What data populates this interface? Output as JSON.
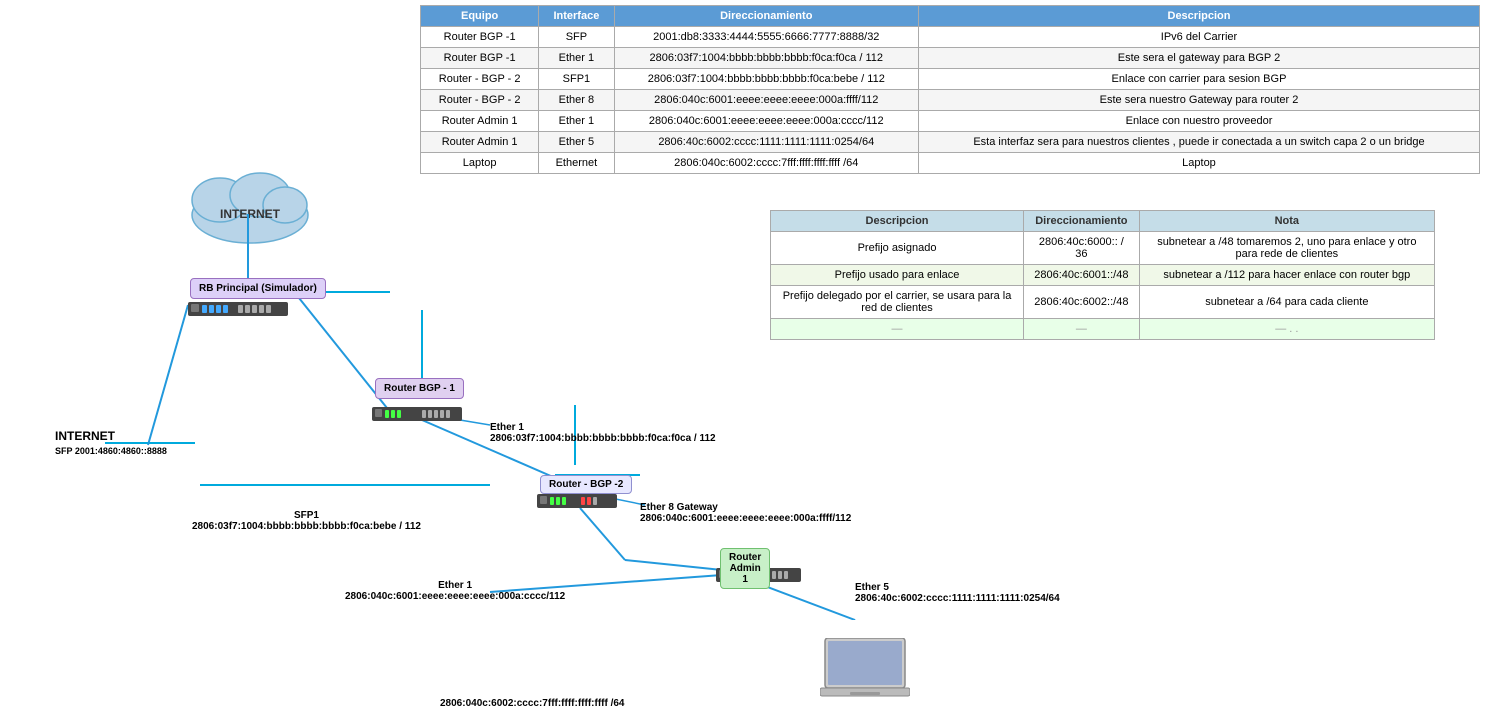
{
  "tables": {
    "main": {
      "headers": [
        "Equipo",
        "Interface",
        "Direccionamiento",
        "Descripcion"
      ],
      "rows": [
        {
          "equipo": "Router BGP -1",
          "interface": "SFP",
          "direccionamiento": "2001:db8:3333:4444:5555:6666:7777:8888/32",
          "descripcion": "IPv6 del Carrier"
        },
        {
          "equipo": "Router BGP -1",
          "interface": "Ether 1",
          "direccionamiento": "2806:03f7:1004:bbbb:bbbb:bbbb:f0ca:f0ca / 112",
          "descripcion": "Este sera el gateway para BGP 2"
        },
        {
          "equipo": "Router - BGP - 2",
          "interface": "SFP1",
          "direccionamiento": "2806:03f7:1004:bbbb:bbbb:bbbb:f0ca:bebe / 112",
          "descripcion": "Enlace con carrier para sesion BGP"
        },
        {
          "equipo": "Router - BGP - 2",
          "interface": "Ether 8",
          "direccionamiento": "2806:040c:6001:eeee:eeee:eeee:000a:ffff/112",
          "descripcion": "Este sera nuestro Gateway para router 2"
        },
        {
          "equipo": "Router Admin 1",
          "interface": "Ether 1",
          "direccionamiento": "2806:040c:6001:eeee:eeee:eeee:000a:cccc/112",
          "descripcion": "Enlace con nuestro proveedor"
        },
        {
          "equipo": "Router Admin 1",
          "interface": "Ether 5",
          "direccionamiento": "2806:40c:6002:cccc:1111:1111:1111:0254/64",
          "descripcion": "Esta interfaz sera para nuestros clientes , puede ir conectada a un switch capa 2 o un bridge"
        },
        {
          "equipo": "Laptop",
          "interface": "Ethernet",
          "direccionamiento": "2806:040c:6002:cccc:7fff:ffff:ffff:ffff /64",
          "descripcion": "Laptop"
        }
      ]
    },
    "second": {
      "headers": [
        "Descripcion",
        "Direccionamiento",
        "Nota"
      ],
      "rows": [
        {
          "descripcion": "Prefijo asignado",
          "direccionamiento": "2806:40c:6000:: / 36",
          "nota": "subnetear a /48  tomaremos 2, uno para enlace y otro para rede de clientes"
        },
        {
          "descripcion": "Prefijo usado para enlace",
          "direccionamiento": "2806:40c:6001::/48",
          "nota": "subnetear a /112 para hacer enlace con router bgp"
        },
        {
          "descripcion": "Prefijo delegado por el carrier, se usara para la red de clientes",
          "direccionamiento": "2806:40c:6002::/48",
          "nota": "subnetear a /64 para cada cliente"
        },
        {
          "descripcion": "—",
          "direccionamiento": "—",
          "nota": "— . ."
        }
      ]
    }
  },
  "diagram": {
    "internet_label": "INTERNET",
    "rb_principal_label": "RB Principal\n(Simulador)",
    "router_bgp1_label": "Router BGP -\n1",
    "router_bgp2_label": "Router - BGP -2",
    "router_admin1_label": "Router Admin 1",
    "internet_sfp_label": "INTERNET\nSFP 2001:4860:4860::8888",
    "ether1_bgp1_label": "Ether 1",
    "ether1_bgp1_addr": "2806:03f7:1004:bbbb:bbbb:bbbb:f0ca:f0ca / 112",
    "sfp1_label": "SFP1",
    "sfp1_addr": "2806:03f7:1004:bbbb:bbbb:bbbb:f0ca:bebe / 112",
    "ether8_label": "Ether 8 Gateway",
    "ether8_addr": "2806:040c:6001:eeee:eeee:eeee:000a:ffff/112",
    "ether1_admin_label": "Ether 1",
    "ether1_admin_addr": "2806:040c:6001:eeee:eeee:eeee:000a:cccc/112",
    "ether5_label": "Ether 5",
    "ether5_addr": "2806:40c:6002:cccc:1111:1111:1111:0254/64",
    "laptop_addr": "2806:040c:6002:cccc:7fff:ffff:ffff:ffff /64"
  }
}
